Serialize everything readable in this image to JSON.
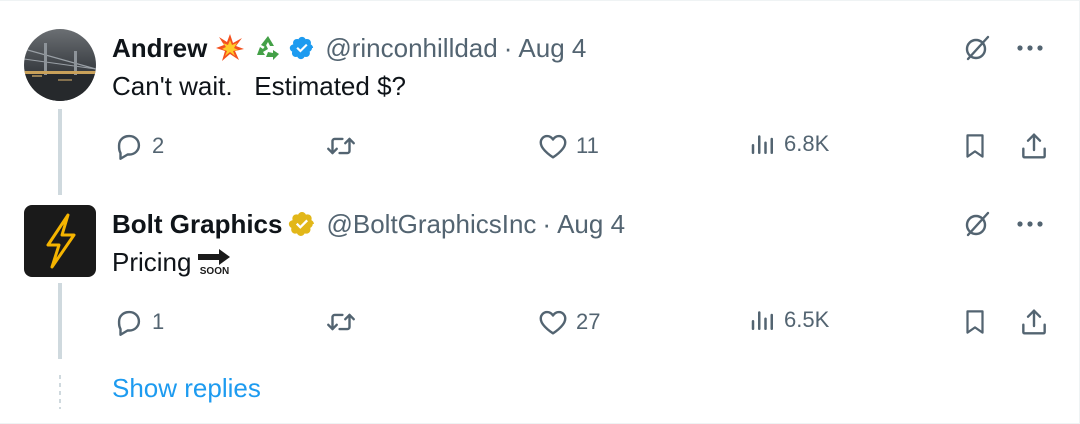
{
  "tweets": [
    {
      "name": "Andrew",
      "emojis": [
        "collision-emoji",
        "recycle-emoji"
      ],
      "verified": "blue",
      "handle": "@rinconhilldad",
      "separator": "·",
      "date": "Aug 4",
      "text": "Can't wait.   Estimated $?",
      "replies": "2",
      "retweets": "",
      "likes": "11",
      "views": "6.8K"
    },
    {
      "name": "Bolt Graphics",
      "verified": "gold",
      "handle": "@BoltGraphicsInc",
      "separator": "·",
      "date": "Aug 4",
      "text": "Pricing",
      "text_emoji": "soon-arrow-emoji",
      "soon_label": "SOON",
      "replies": "1",
      "retweets": "",
      "likes": "27",
      "views": "6.5K"
    }
  ],
  "show_replies": "Show replies",
  "colors": {
    "text_primary": "#0f1419",
    "text_secondary": "#536471",
    "link": "#1d9bf0",
    "verified_blue": "#1d9bf0",
    "verified_gold": "#e2b719",
    "thread_line": "#cfd9de"
  }
}
